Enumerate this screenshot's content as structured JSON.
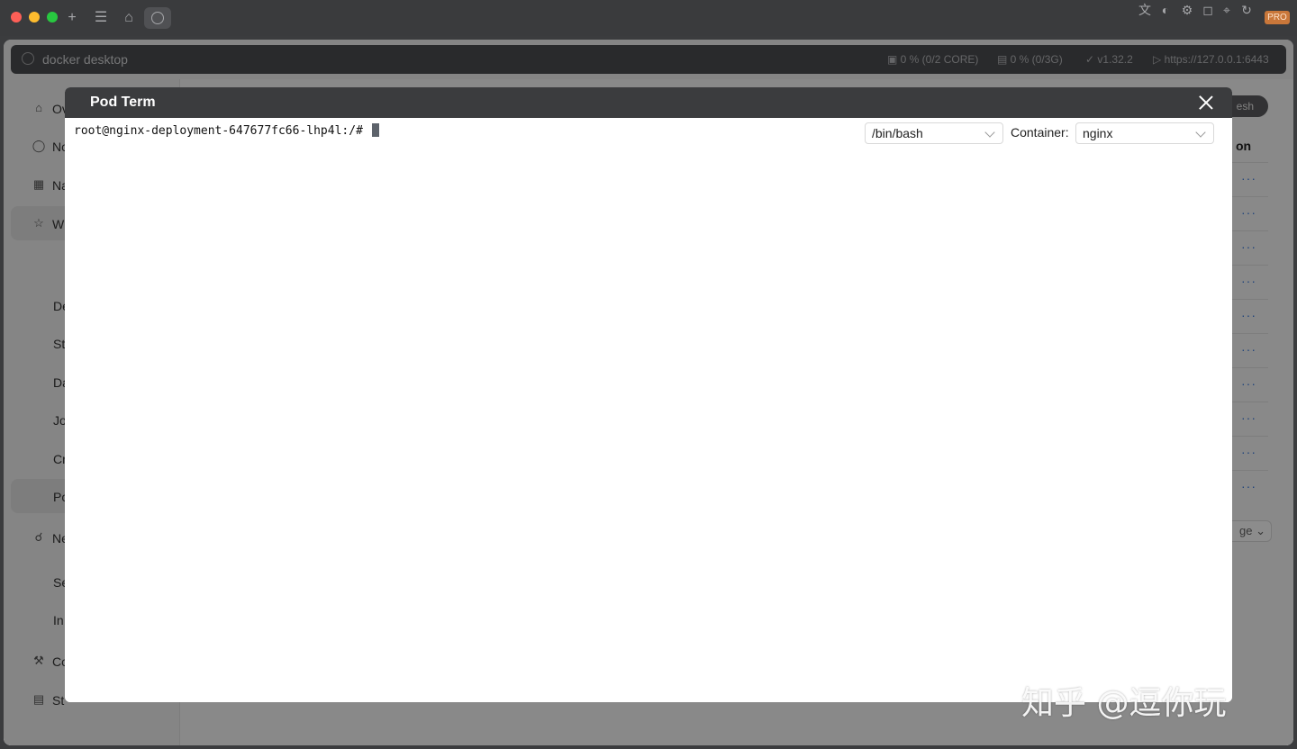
{
  "titlebar": {
    "icons": [
      "plus-icon",
      "list-icon",
      "home-icon",
      "kubernetes-icon"
    ],
    "right_icons": [
      "translate-icon",
      "contrast-icon",
      "gear-icon",
      "shirt-icon",
      "target-icon",
      "refresh-icon"
    ],
    "pro_badge": "PRO"
  },
  "app": {
    "title": "docker desktop",
    "cpu": "0 % (0/2 CORE)",
    "memory": "0 % (0/3G)",
    "version": "v1.32.2",
    "server": "https://127.0.0.1:6443"
  },
  "sidebar": {
    "items": [
      {
        "label": "Ov",
        "icon": "home-icon"
      },
      {
        "label": "No",
        "icon": "node-icon"
      },
      {
        "label": "Na",
        "icon": "table-icon"
      },
      {
        "label": "W",
        "icon": "workload-icon"
      },
      {
        "label": "De",
        "icon": ""
      },
      {
        "label": "St",
        "icon": ""
      },
      {
        "label": "Da",
        "icon": ""
      },
      {
        "label": "Jo",
        "icon": ""
      },
      {
        "label": "Cr",
        "icon": ""
      },
      {
        "label": "Po",
        "icon": ""
      },
      {
        "label": "Ne",
        "icon": "globe-icon"
      },
      {
        "label": "Se",
        "icon": ""
      },
      {
        "label": "In",
        "icon": ""
      },
      {
        "label": "Co",
        "icon": "wrench-icon"
      },
      {
        "label": "St",
        "icon": "storage-icon"
      }
    ]
  },
  "main": {
    "refresh_label": "esh",
    "action_header": "on",
    "row_action": "···",
    "page_size": "ge"
  },
  "modal": {
    "title": "Pod Term",
    "prompt": "root@nginx-deployment-647677fc66-lhp4l:/# ",
    "shell_value": "/bin/bash",
    "container_label": "Container:",
    "container_value": "nginx"
  },
  "watermark": "知乎 @逗你玩"
}
